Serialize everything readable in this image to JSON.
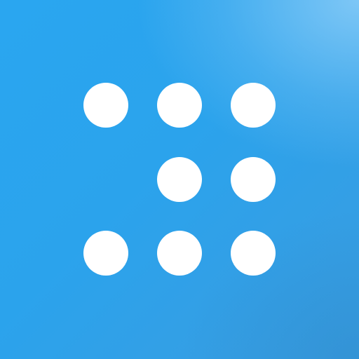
{
  "icon": {
    "name": "dot-grid-app-icon",
    "background_colors": [
      "#2aa6f0",
      "#2ba3ec",
      "#3a9ce0",
      "#8ccdf8"
    ],
    "dot_color": "#ffffff",
    "grid": {
      "rows": 3,
      "columns": 3,
      "filled": [
        [
          true,
          true,
          true
        ],
        [
          false,
          true,
          true
        ],
        [
          true,
          true,
          true
        ]
      ]
    }
  }
}
